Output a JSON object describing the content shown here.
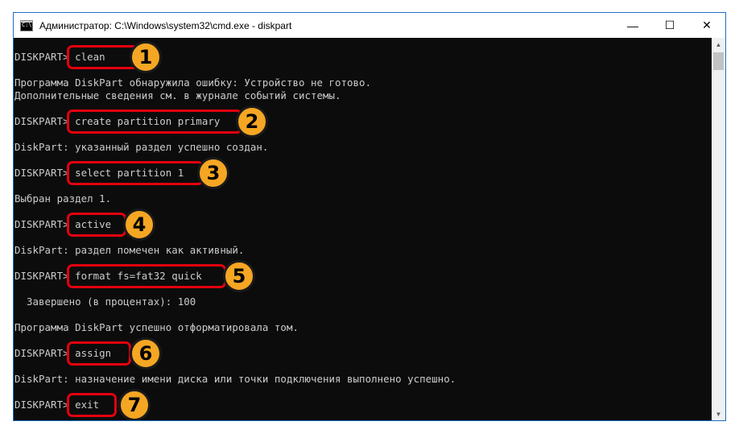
{
  "window": {
    "title": "Администратор: C:\\Windows\\system32\\cmd.exe - diskpart",
    "icon_text": "C:\\",
    "controls": {
      "minimize": "—",
      "maximize": "☐",
      "close": "✕"
    }
  },
  "console": {
    "prompt": "DISKPART>",
    "commands": [
      {
        "text": "clean",
        "number": "1"
      },
      {
        "text": "create partition primary",
        "number": "2"
      },
      {
        "text": "select partition 1",
        "number": "3"
      },
      {
        "text": "active",
        "number": "4"
      },
      {
        "text": "format fs=fat32 quick",
        "number": "5"
      },
      {
        "text": "assign",
        "number": "6"
      },
      {
        "text": "exit",
        "number": "7"
      }
    ],
    "outputs": [
      "Программа DiskPart обнаружила ошибку: Устройство не готово.",
      "Дополнительные сведения см. в журнале событий системы.",
      "DiskPart: указанный раздел успешно создан.",
      "Выбран раздел 1.",
      "DiskPart: раздел помечен как активный.",
      "  Завершено (в процентах): 100",
      "Программа DiskPart успешно отформатировала том.",
      "DiskPart: назначение имени диска или точки подключения выполнено успешно."
    ]
  },
  "colors": {
    "console_bg": "#0c0c0c",
    "console_text": "#cccccc",
    "highlight": "#e3000f",
    "badge": "#f5a623"
  }
}
